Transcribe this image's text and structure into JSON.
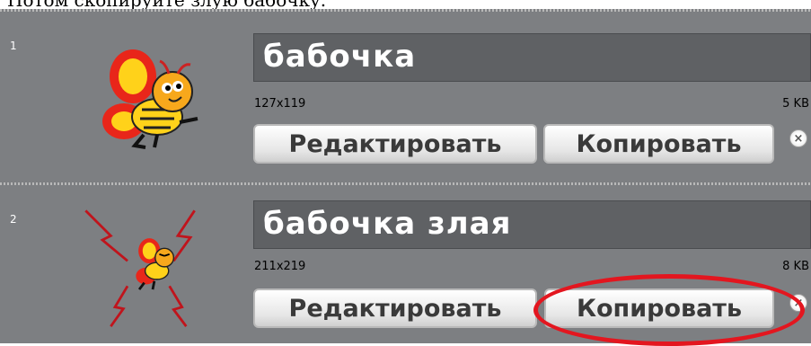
{
  "caption": "Потом скопируйте злую бабочку.",
  "sprites": [
    {
      "index": "1",
      "name": "бабочка",
      "dims": "127x119",
      "size": "5 KB",
      "edit_label": "Редактировать",
      "copy_label": "Копировать",
      "delete_icon": "close-icon",
      "thumb_icon": "butterfly-icon"
    },
    {
      "index": "2",
      "name": "бабочка злая",
      "dims": "211x219",
      "size": "8 KB",
      "edit_label": "Редактировать",
      "copy_label": "Копировать",
      "delete_icon": "close-icon",
      "thumb_icon": "angry-butterfly-icon"
    }
  ],
  "colors": {
    "panel": "#7d7f82",
    "name_box": "#5f6164",
    "highlight": "#e3161f"
  }
}
